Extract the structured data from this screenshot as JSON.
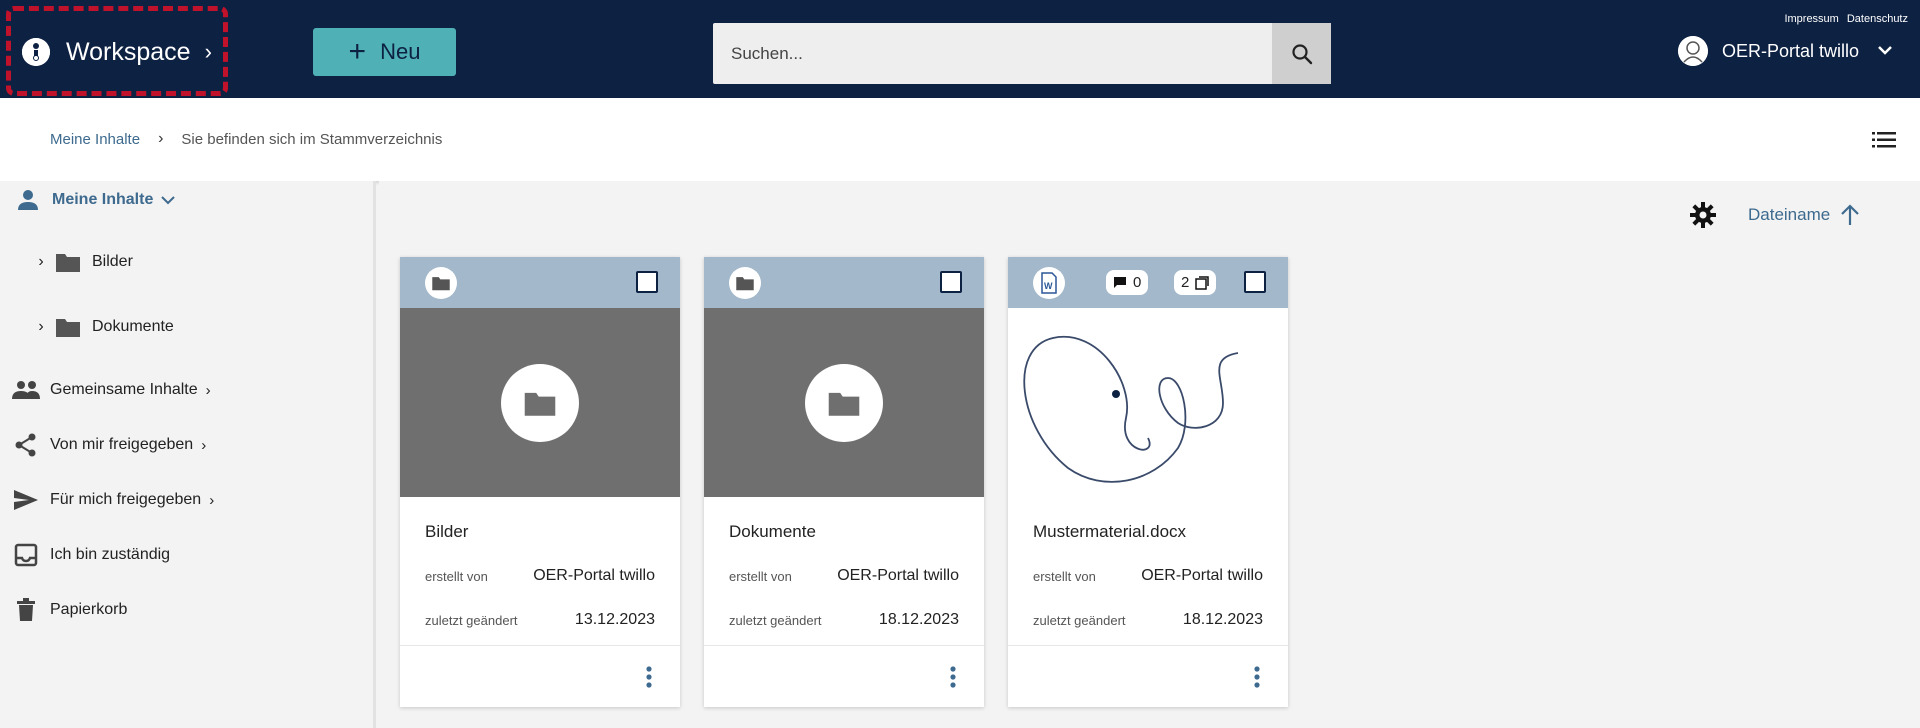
{
  "header": {
    "workspace_label": "Workspace",
    "new_label": "Neu",
    "search_placeholder": "Suchen...",
    "links": [
      "Impressum",
      "Datenschutz"
    ],
    "user_name": "OER-Portal twillo"
  },
  "breadcrumb": {
    "home": "Meine Inhalte",
    "current": "Sie befinden sich im Stammverzeichnis"
  },
  "sidebar": {
    "items": [
      {
        "label": "Meine Inhalte",
        "icon": "person-icon"
      },
      {
        "label": "Bilder",
        "icon": "folder-icon"
      },
      {
        "label": "Dokumente",
        "icon": "folder-icon"
      },
      {
        "label": "Gemeinsame Inhalte",
        "icon": "group-icon"
      },
      {
        "label": "Von mir freigegeben",
        "icon": "share-icon"
      },
      {
        "label": "Für mich freigegeben",
        "icon": "send-icon"
      },
      {
        "label": "Ich bin zuständig",
        "icon": "inbox-icon"
      },
      {
        "label": "Papierkorb",
        "icon": "trash-icon"
      }
    ]
  },
  "sort": {
    "label": "Dateiname"
  },
  "cards": [
    {
      "title": "Bilder",
      "created_by_label": "erstellt von",
      "created_by": "OER-Portal twillo",
      "modified_label": "zuletzt geändert",
      "modified": "13.12.2023"
    },
    {
      "title": "Dokumente",
      "created_by_label": "erstellt von",
      "created_by": "OER-Portal twillo",
      "modified_label": "zuletzt geändert",
      "modified": "18.12.2023"
    },
    {
      "title": "Mustermaterial.docx",
      "created_by_label": "erstellt von",
      "created_by": "OER-Portal twillo",
      "modified_label": "zuletzt geändert",
      "modified": "18.12.2023",
      "comments": "0",
      "versions": "2"
    }
  ],
  "colors": {
    "header_bg": "#0d2143",
    "accent": "#4fb0b5",
    "link": "#3d6a8e",
    "highlight": "#c0122a"
  }
}
